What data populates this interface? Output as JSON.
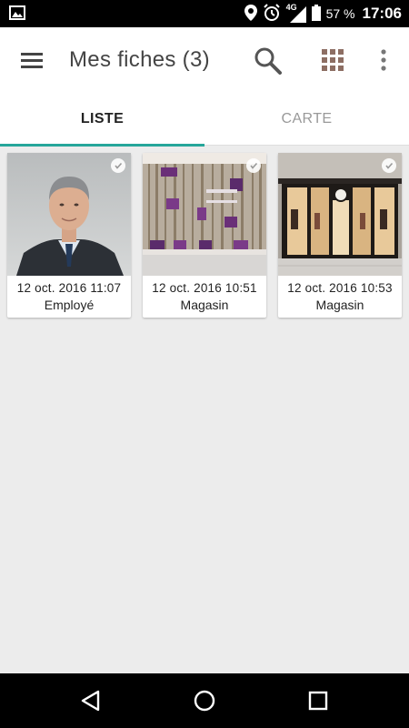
{
  "status_bar": {
    "network": "4G",
    "battery": "57 %",
    "time": "17:06"
  },
  "app_bar": {
    "title": "Mes fiches (3)"
  },
  "tabs": [
    {
      "label": "LISTE",
      "active": true
    },
    {
      "label": "CARTE",
      "active": false
    }
  ],
  "colors": {
    "accent": "#26a69a",
    "title_text": "#444444",
    "inactive_tab": "#999999",
    "background": "#ececec"
  },
  "cards": [
    {
      "date": "12 oct. 2016 11:07",
      "type": "Employé",
      "image": "portrait-photo",
      "checked": true
    },
    {
      "date": "12 oct. 2016 10:51",
      "type": "Magasin",
      "image": "shop-window-photo",
      "checked": true
    },
    {
      "date": "12 oct. 2016 10:53",
      "type": "Magasin",
      "image": "storefront-photo",
      "checked": true
    }
  ],
  "icons": {
    "status_left": "image-notification-icon",
    "menu": "hamburger-menu-icon",
    "search": "search-icon",
    "grid": "grid-view-icon",
    "more": "more-vert-icon",
    "nav_back": "back-triangle-icon",
    "nav_home": "home-circle-icon",
    "nav_recents": "recents-square-icon"
  }
}
